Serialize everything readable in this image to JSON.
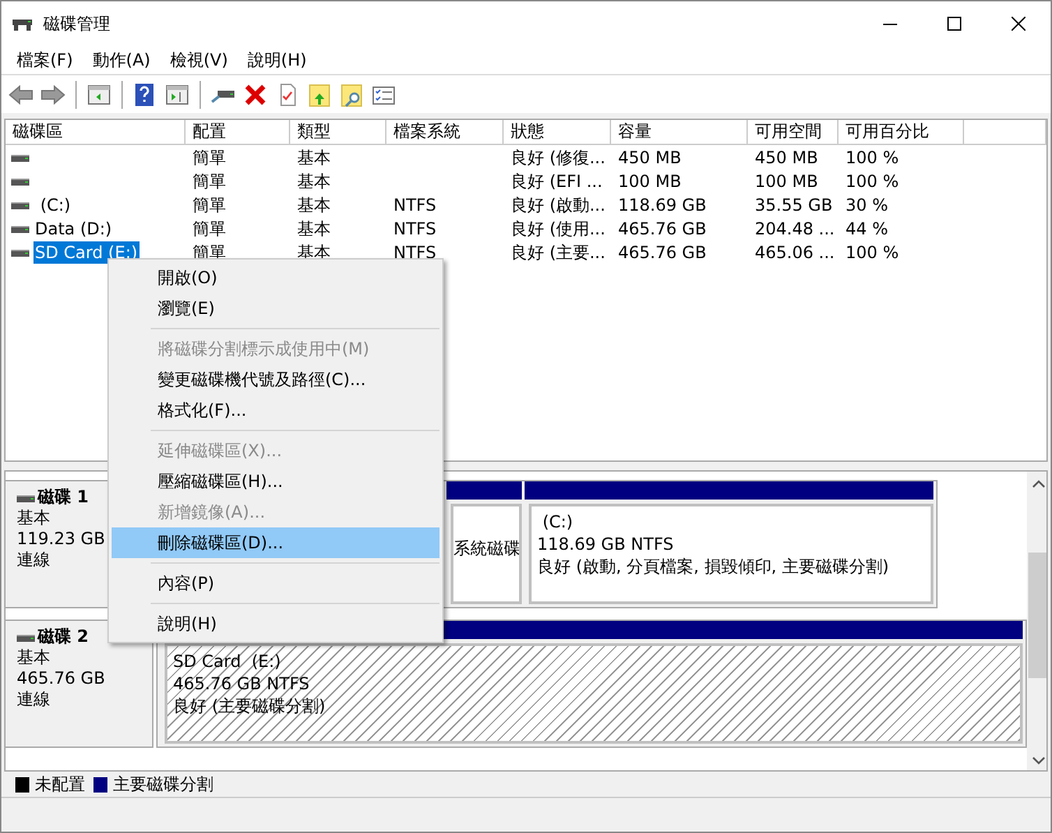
{
  "window": {
    "title": "磁碟管理"
  },
  "menu_bar": [
    "檔案(F)",
    "動作(A)",
    "檢視(V)",
    "說明(H)"
  ],
  "volume_list": {
    "columns": [
      "磁碟區",
      "配置",
      "類型",
      "檔案系統",
      "狀態",
      "容量",
      "可用空間",
      "可用百分比"
    ],
    "rows": [
      {
        "selected": false,
        "cells": [
          "",
          "簡單",
          "基本",
          "",
          "良好 (修復...",
          "450 MB",
          "450 MB",
          "100 %"
        ]
      },
      {
        "selected": false,
        "cells": [
          "",
          "簡單",
          "基本",
          "",
          "良好 (EFI ...",
          "100 MB",
          "100 MB",
          "100 %"
        ]
      },
      {
        "selected": false,
        "cells": [
          " (C:)",
          "簡單",
          "基本",
          "NTFS",
          "良好 (啟動...",
          "118.69 GB",
          "35.55 GB",
          "30 %"
        ]
      },
      {
        "selected": false,
        "cells": [
          "Data (D:)",
          "簡單",
          "基本",
          "NTFS",
          "良好 (使用...",
          "465.76 GB",
          "204.48 ...",
          "44 %"
        ]
      },
      {
        "selected": true,
        "cells": [
          "SD Card (E:)",
          "簡單",
          "基本",
          "NTFS",
          "良好 (主要...",
          "465.76 GB",
          "465.06 ...",
          "100 %"
        ]
      }
    ]
  },
  "disks": [
    {
      "name": "磁碟 1",
      "type": "基本",
      "size": "119.23 GB",
      "status": "連線",
      "partitions": [
        {
          "selected": false,
          "status": "系統磁碟"
        },
        {
          "selected": false,
          "label": " (C:)",
          "detail": "118.69 GB NTFS",
          "status": "良好 (啟動, 分頁檔案, 損毀傾印, 主要磁碟分割)"
        }
      ]
    },
    {
      "name": "磁碟 2",
      "type": "基本",
      "size": "465.76 GB",
      "status": "連線",
      "partitions": [
        {
          "selected": true,
          "label": "SD Card  (E:)",
          "detail": "465.76 GB NTFS",
          "status": "良好 (主要磁碟分割)"
        }
      ]
    }
  ],
  "legend": [
    {
      "label": "未配置",
      "color": "#000000"
    },
    {
      "label": "主要磁碟分割",
      "color": "#000080"
    }
  ],
  "context_menu": [
    {
      "kind": "item",
      "label": "開啟(O)",
      "disabled": false,
      "selected": false
    },
    {
      "kind": "item",
      "label": "瀏覽(E)",
      "disabled": false,
      "selected": false
    },
    {
      "kind": "separator"
    },
    {
      "kind": "item",
      "label": "將磁碟分割標示成使用中(M)",
      "disabled": true,
      "selected": false
    },
    {
      "kind": "item",
      "label": "變更磁碟機代號及路徑(C)...",
      "disabled": false,
      "selected": false
    },
    {
      "kind": "item",
      "label": "格式化(F)...",
      "disabled": false,
      "selected": false
    },
    {
      "kind": "separator"
    },
    {
      "kind": "item",
      "label": "延伸磁碟區(X)...",
      "disabled": true,
      "selected": false
    },
    {
      "kind": "item",
      "label": "壓縮磁碟區(H)...",
      "disabled": false,
      "selected": false
    },
    {
      "kind": "item",
      "label": "新增鏡像(A)...",
      "disabled": true,
      "selected": false
    },
    {
      "kind": "item",
      "label": "刪除磁碟區(D)...",
      "disabled": false,
      "selected": true
    },
    {
      "kind": "separator"
    },
    {
      "kind": "item",
      "label": "內容(P)",
      "disabled": false,
      "selected": false
    },
    {
      "kind": "separator"
    },
    {
      "kind": "item",
      "label": "說明(H)",
      "disabled": false,
      "selected": false
    }
  ]
}
